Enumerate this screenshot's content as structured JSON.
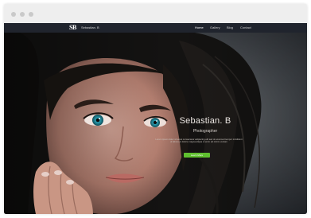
{
  "header": {
    "logo": "SB",
    "brand_name": "Sebastian. B"
  },
  "nav": {
    "items": [
      {
        "label": "Home"
      },
      {
        "label": "Gallery"
      },
      {
        "label": "Blog"
      },
      {
        "label": "Contact"
      }
    ]
  },
  "hero": {
    "title": "Sebastian. B",
    "subtitle": "Photographer",
    "description": "Lorem ipsum dolor sit amet consectetur adipiscing elit sed do eiusmod tempor incididunt ut labore et dolore magna aliqua ut enim ad minim veniam",
    "cta_label": "Learn More"
  },
  "colors": {
    "navbar": "#20242d",
    "accent": "#5fbf2f",
    "frame": "#eeeeee"
  }
}
